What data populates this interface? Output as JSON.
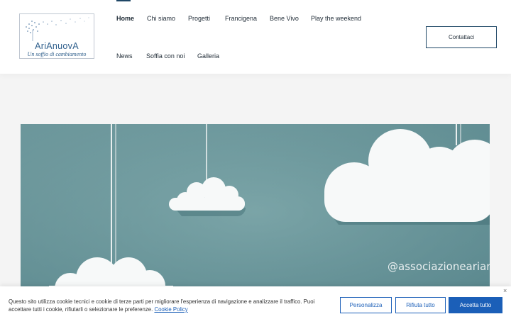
{
  "logo": {
    "name": "AriAnuovA",
    "tagline": "Un soffio di cambiamento"
  },
  "nav": {
    "home": "Home",
    "chi_siamo": "Chi siamo",
    "progetti": "Progetti",
    "francigena": "Francigena",
    "bene_vivo": "Bene Vivo",
    "play_weekend": "Play the weekend",
    "news": "News",
    "soffia": "Soffia con noi",
    "galleria": "Galleria"
  },
  "contact_label": "Contattaci",
  "hero": {
    "watermark": "@associazionearianu"
  },
  "cookie": {
    "text": "Questo sito utilizza cookie tecnici e cookie di terze parti per migliorare l'esperienza di navigazione e analizzare il traffico. Puoi accettare tutti i cookie, rifiutarli o selezionare le preferenze.",
    "link": "Cookie Policy",
    "customize": "Personalizza",
    "reject": "Rifiuta tutto",
    "accept": "Accetta tutto",
    "close": "×"
  },
  "colors": {
    "accent": "#1f4766",
    "cookie_blue": "#1b5fb8",
    "hero_bg": "#6f9a9e"
  }
}
